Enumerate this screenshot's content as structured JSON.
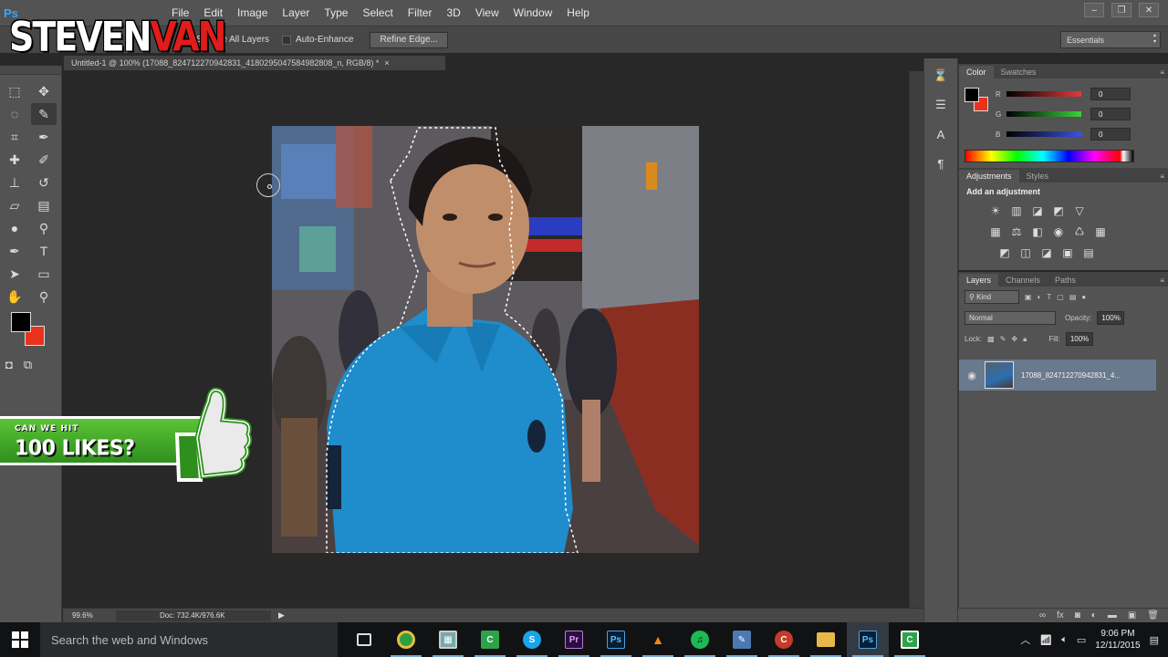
{
  "app": {
    "logo": "Ps",
    "menus": [
      "File",
      "Edit",
      "Image",
      "Layer",
      "Type",
      "Select",
      "Filter",
      "3D",
      "View",
      "Window",
      "Help"
    ],
    "window_controls": [
      "–",
      "❐",
      "✕"
    ]
  },
  "watermark": {
    "part1": "STEVEN",
    "part2": "VAN"
  },
  "options_bar": {
    "sample_all_layers": "Sample All Layers",
    "auto_enhance": "Auto-Enhance",
    "refine_edge": "Refine Edge...",
    "workspace": "Essentials"
  },
  "document": {
    "tab_title": "Untitled-1 @ 100% (17088_824712270942831_4180295047584982808_n, RGB/8) *",
    "close": "×"
  },
  "status_bar": {
    "zoom": "99.6%",
    "doc_info": "Doc: 732.4K/976.6K",
    "arrow": "▶"
  },
  "color_panel": {
    "tabs": [
      "Color",
      "Swatches"
    ],
    "channels": [
      {
        "label": "R",
        "value": "0",
        "color": "#e23b3b"
      },
      {
        "label": "G",
        "value": "0",
        "color": "#3bd23b"
      },
      {
        "label": "B",
        "value": "0",
        "color": "#3b52e2"
      }
    ],
    "foreground": "#000000",
    "background": "#e8321e"
  },
  "adjustments_panel": {
    "tabs": [
      "Adjustments",
      "Styles"
    ],
    "title": "Add an adjustment",
    "rows": [
      [
        "☀",
        "▥",
        "◪",
        "◩",
        "▽"
      ],
      [
        "▦",
        "⚖",
        "◧",
        "◉",
        "♺",
        "▦"
      ],
      [
        "◩",
        "◫",
        "◪",
        "▣",
        "▤"
      ]
    ]
  },
  "layers_panel": {
    "tabs": [
      "Layers",
      "Channels",
      "Paths"
    ],
    "filter_kind": "Kind",
    "blend_mode": "Normal",
    "opacity_label": "Opacity:",
    "opacity_value": "100%",
    "lock_label": "Lock:",
    "fill_label": "Fill:",
    "fill_value": "100%",
    "layer_name": "17088_824712270942831_4..."
  },
  "likes_badge": {
    "line1": "CAN WE HIT",
    "line2": "100 LIKES?"
  },
  "taskbar": {
    "search_placeholder": "Search the web and Windows",
    "time": "9:06 PM",
    "date": "12/11/2015",
    "apps": [
      {
        "name": "task-view",
        "glyph": "▭",
        "color": "#111214"
      },
      {
        "name": "chrome",
        "glyph": "◉",
        "color": "#2e9e44"
      },
      {
        "name": "media-player",
        "glyph": "▦",
        "color": "#3a5a3a"
      },
      {
        "name": "camtasia",
        "glyph": "C",
        "color": "#2ea24a"
      },
      {
        "name": "skype",
        "glyph": "S",
        "color": "#1aa3e8"
      },
      {
        "name": "premiere",
        "glyph": "Pr",
        "color": "#3d1a55"
      },
      {
        "name": "photoshop",
        "glyph": "Ps",
        "color": "#0d2b4a"
      },
      {
        "name": "vlc",
        "glyph": "▲",
        "color": "#e07a12"
      },
      {
        "name": "spotify",
        "glyph": "♫",
        "color": "#1db954"
      },
      {
        "name": "image-editor",
        "glyph": "✎",
        "color": "#4a7ab0"
      },
      {
        "name": "ccleaner",
        "glyph": "C",
        "color": "#c63a2a"
      },
      {
        "name": "file-explorer",
        "glyph": "▬",
        "color": "#e8b84a"
      },
      {
        "name": "photoshop-active",
        "glyph": "Ps",
        "color": "#0d2b4a"
      },
      {
        "name": "camtasia-recorder",
        "glyph": "C",
        "color": "#2ea24a"
      }
    ]
  }
}
